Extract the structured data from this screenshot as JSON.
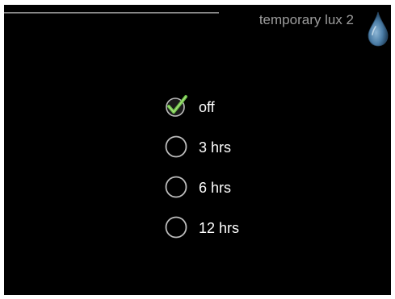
{
  "header": {
    "title": "temporary lux 2",
    "icon": "water-drop-icon"
  },
  "options": [
    {
      "label": "off",
      "selected": true,
      "icon": "check-icon"
    },
    {
      "label": "3 hrs",
      "selected": false,
      "icon": "radio-empty-icon"
    },
    {
      "label": "6 hrs",
      "selected": false,
      "icon": "radio-empty-icon"
    },
    {
      "label": "12 hrs",
      "selected": false,
      "icon": "radio-empty-icon"
    }
  ],
  "colors": {
    "background": "#000000",
    "title": "#9d9d9d",
    "label": "#ffffff",
    "check": "#6cc04a",
    "drop": "#4d7fa8"
  }
}
